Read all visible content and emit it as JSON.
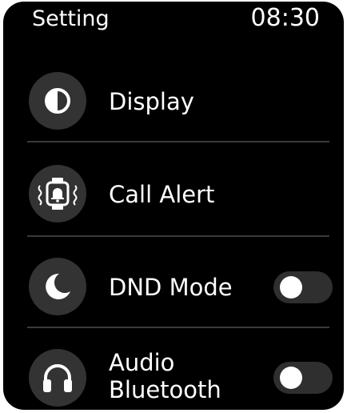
{
  "status_bar": {
    "title": "Setting",
    "time": "08:30"
  },
  "settings": {
    "items": [
      {
        "label": "Display",
        "icon": "contrast-icon",
        "has_toggle": false
      },
      {
        "label": "Call Alert",
        "icon": "watch-vibrate-bell-icon",
        "has_toggle": false
      },
      {
        "label": "DND Mode",
        "icon": "moon-icon",
        "has_toggle": true,
        "toggle_on": false
      },
      {
        "label": "Audio Bluetooth",
        "icon": "headphones-icon",
        "has_toggle": true,
        "toggle_on": false
      }
    ]
  },
  "colors": {
    "background": "#000000",
    "icon_circle": "#333333",
    "divider": "#3a3a3a",
    "toggle_track_off": "#2f2f2f",
    "toggle_knob": "#ffffff",
    "text": "#ffffff"
  }
}
